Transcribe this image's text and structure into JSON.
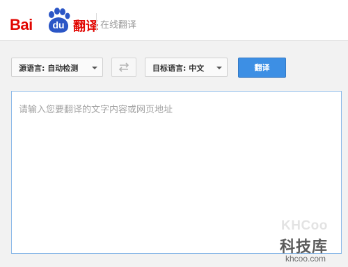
{
  "header": {
    "logo_bai": "Bai",
    "logo_du": "du",
    "logo_fanyi": "翻译",
    "tagline": "在线翻译"
  },
  "toolbar": {
    "source_lang_label": "源语言: 自动检测",
    "target_lang_label": "目标语言: 中文",
    "swap_icon": "swap-arrows-icon",
    "translate_label": "翻译"
  },
  "input": {
    "placeholder": "请输入您要翻译的文字内容或网页地址",
    "value": ""
  },
  "watermark": {
    "brand": "KHCoo",
    "name": "科技库",
    "url": "khcoo.com"
  },
  "colors": {
    "brand_red": "#e10601",
    "brand_blue": "#2b56c6",
    "button_blue": "#3d8fe4",
    "textarea_border": "#8cb9e8"
  }
}
